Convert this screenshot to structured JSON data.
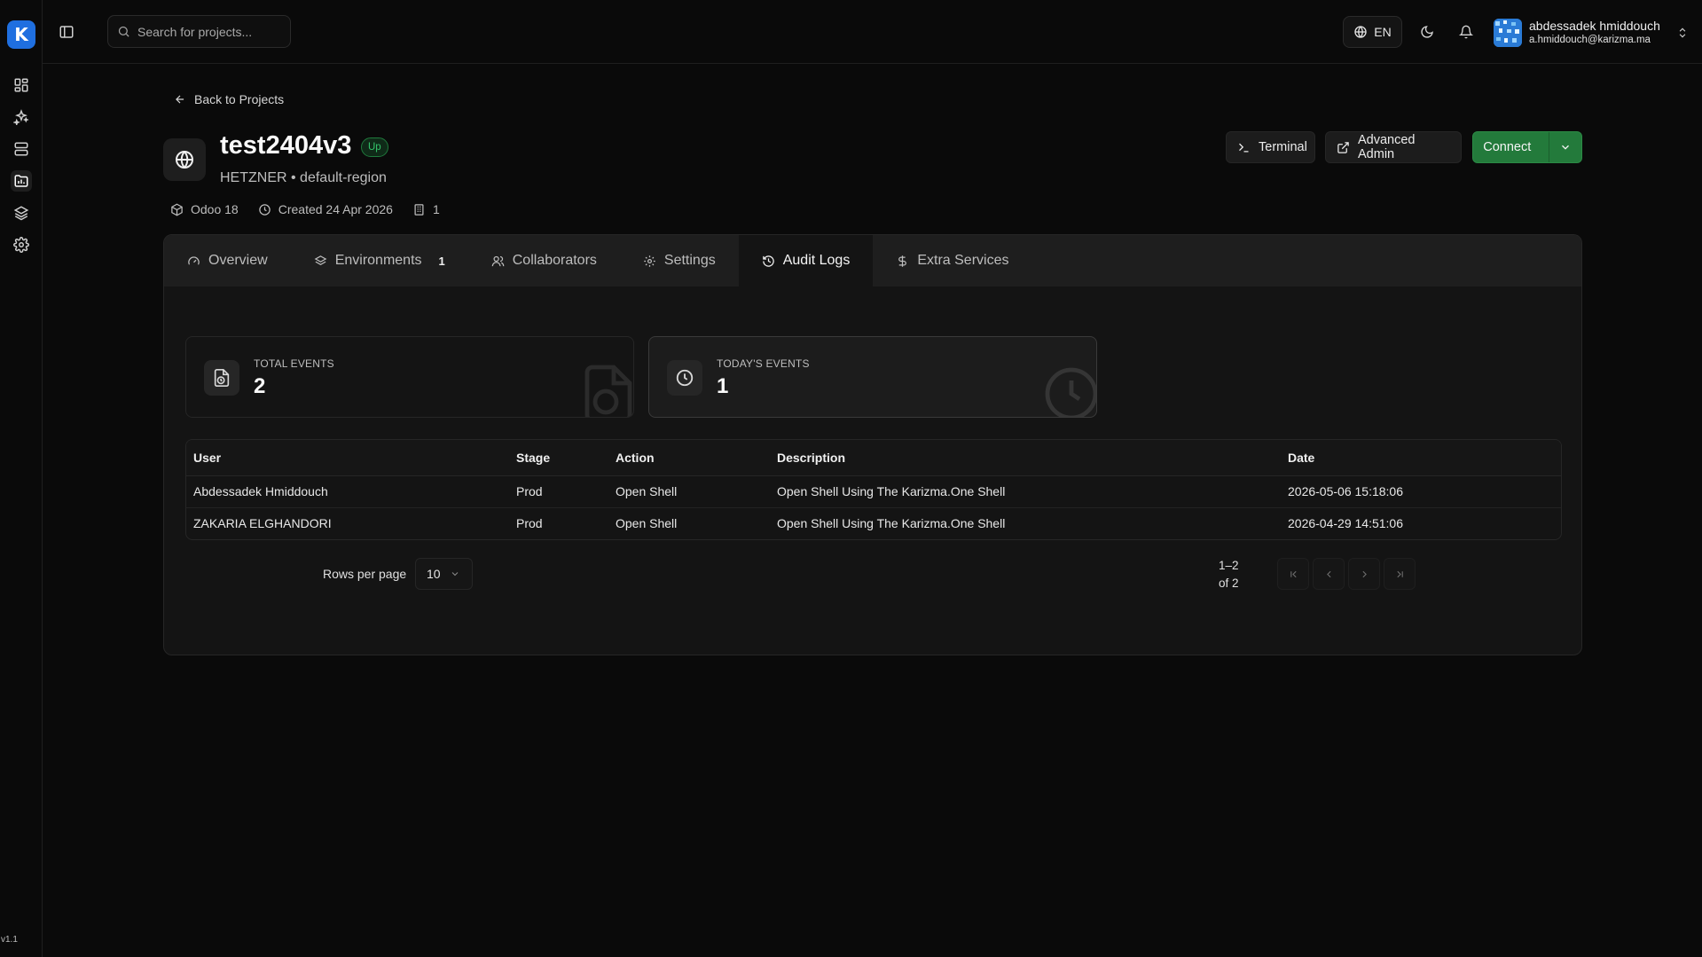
{
  "app": {
    "logo_text": "K",
    "version": "v1.1",
    "accent_color": "#237a3b",
    "brand_color": "#1f6fe0"
  },
  "sidebar": {
    "items": [
      {
        "icon": "dashboard-icon"
      },
      {
        "icon": "sparkles-icon"
      },
      {
        "icon": "server-icon"
      },
      {
        "icon": "project-folder-icon",
        "active": true
      },
      {
        "icon": "layers-icon"
      },
      {
        "icon": "gear-icon"
      }
    ]
  },
  "topbar": {
    "search_placeholder": "Search for projects...",
    "language": "EN",
    "user": {
      "name": "abdessadek hmiddouch",
      "email": "a.hmiddouch@karizma.ma"
    }
  },
  "header": {
    "back_label": "Back to Projects",
    "project_name": "test2404v3",
    "status": "Up",
    "subtitle": "HETZNER • default-region",
    "meta": {
      "version": "Odoo 18",
      "created": "Created 24 Apr 2026",
      "instances": "1"
    },
    "actions": {
      "terminal": "Terminal",
      "advanced_admin": "Advanced Admin",
      "connect": "Connect"
    }
  },
  "tabs": [
    {
      "label": "Overview"
    },
    {
      "label": "Environments",
      "count": "1"
    },
    {
      "label": "Collaborators"
    },
    {
      "label": "Settings"
    },
    {
      "label": "Audit Logs",
      "active": true
    },
    {
      "label": "Extra Services"
    }
  ],
  "stats": {
    "total": {
      "label": "TOTAL EVENTS",
      "value": "2"
    },
    "today": {
      "label": "TODAY'S EVENTS",
      "value": "1"
    }
  },
  "table": {
    "columns": [
      "User",
      "Stage",
      "Action",
      "Description",
      "Date"
    ],
    "rows": [
      [
        "Abdessadek Hmiddouch",
        "Prod",
        "Open Shell",
        "Open Shell Using The Karizma.One Shell",
        "2026-05-06 15:18:06"
      ],
      [
        "ZAKARIA ELGHANDORI",
        "Prod",
        "Open Shell",
        "Open Shell Using The Karizma.One Shell",
        "2026-04-29 14:51:06"
      ]
    ]
  },
  "pagination": {
    "rows_per_page_label": "Rows per page",
    "rows_per_page": "10",
    "range": "1–2",
    "of": "of 2"
  }
}
